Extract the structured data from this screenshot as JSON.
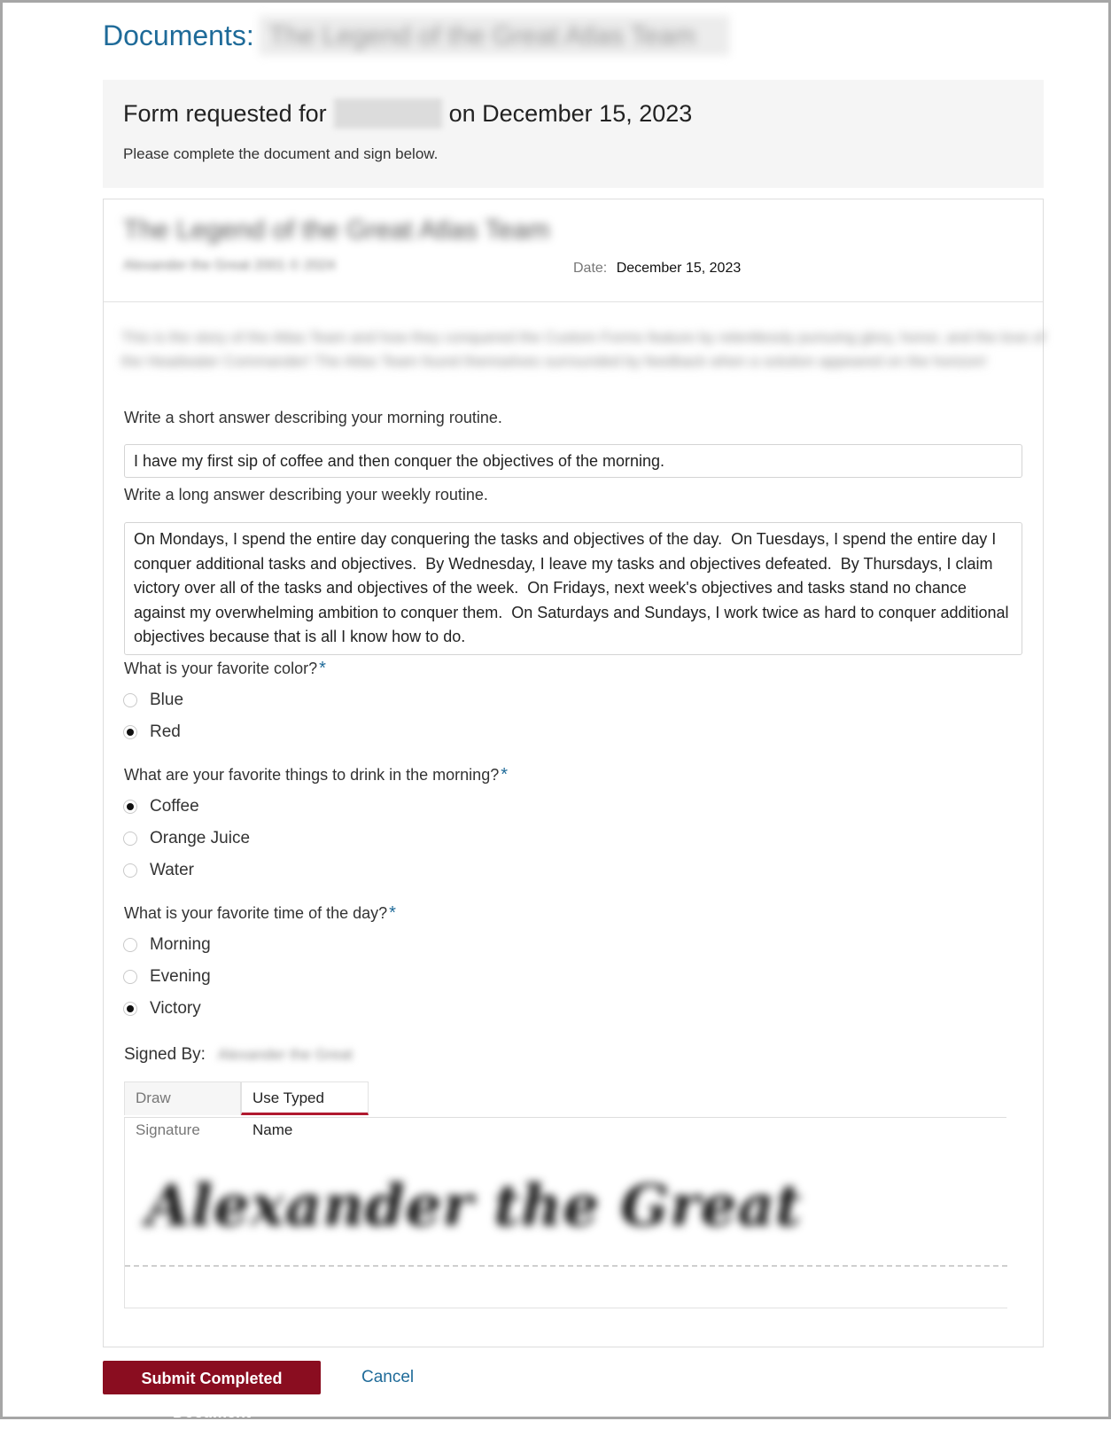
{
  "header": {
    "title_prefix": "Documents:",
    "title_redacted": "The Legend of the Great Atlas Team"
  },
  "request": {
    "title_prefix": "Form requested for",
    "title_suffix": "on December 15, 2023",
    "subtitle": "Please complete the document and sign below."
  },
  "document": {
    "heading": "The Legend of the Great Atlas Team",
    "meta": "Alexander the Great 2001 © 2024",
    "date_label": "Date:",
    "date_value": "December 15, 2023",
    "description": "This is the story of the Atlas Team and how they conquered the Custom Forms feature by relentlessly pursuing glory, honor, and the love of the Headwater Commander! The Atlas Team found themselves surrounded by feedback when a solution appeared on the horizon!"
  },
  "questions": {
    "short": {
      "label": "Write a short answer describing your morning routine.",
      "value": "I have my first sip of coffee and then conquer the objectives of the morning."
    },
    "long": {
      "label": "Write a long answer describing your weekly routine.",
      "value": "On Mondays, I spend the entire day conquering the tasks and objectives of the day.  On Tuesdays, I spend the entire day I conquer additional tasks and objectives.  By Wednesday, I leave my tasks and objectives defeated.  By Thursdays, I claim victory over all of the tasks and objectives of the week.  On Fridays, next week's objectives and tasks stand no chance against my overwhelming ambition to conquer them.  On Saturdays and Sundays, I work twice as hard to conquer additional objectives because that is all I know how to do."
    },
    "color": {
      "label": "What is your favorite color?",
      "required_mark": "*",
      "options": [
        "Blue",
        "Red"
      ],
      "selected": "Red"
    },
    "drink": {
      "label": "What are your favorite things to drink in the morning?",
      "required_mark": "*",
      "options": [
        "Coffee",
        "Orange Juice",
        "Water"
      ],
      "selected": "Coffee"
    },
    "time": {
      "label": "What is your favorite time of the day?",
      "required_mark": "*",
      "options": [
        "Morning",
        "Evening",
        "Victory"
      ],
      "selected": "Victory"
    }
  },
  "signature": {
    "signed_by_label": "Signed By:",
    "signer_redacted": "Alexander the Great",
    "tabs": [
      "Draw Signature",
      "Use Typed Name"
    ],
    "active_tab": "Use Typed Name",
    "typed_signature": "Alexander the Great"
  },
  "actions": {
    "submit_label": "Submit Completed Document",
    "cancel_label": "Cancel"
  },
  "colors": {
    "link": "#1f6b99",
    "submit_bg": "#8a0d20",
    "active_tab_underline": "#b0192f",
    "panel_bg": "#f5f5f5"
  }
}
